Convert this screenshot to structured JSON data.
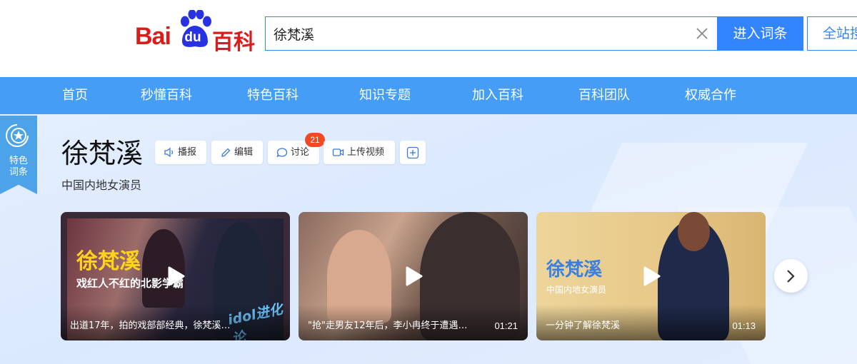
{
  "logo": {
    "part1": "Bai",
    "part2": "du",
    "part3": "百科"
  },
  "search": {
    "value": "徐梵溪",
    "placeholder": ""
  },
  "buttons": {
    "enter": "进入词条",
    "site_search": "全站搜索"
  },
  "nav": {
    "items": [
      "首页",
      "秒懂百科",
      "特色百科",
      "知识专题",
      "加入百科",
      "百科团队",
      "权威合作"
    ]
  },
  "badge": {
    "line1": "特色",
    "line2": "词条"
  },
  "entry": {
    "title": "徐梵溪",
    "subtitle": "中国内地女演员"
  },
  "actions": {
    "broadcast": "播报",
    "edit": "编辑",
    "discuss": "讨论",
    "discuss_count": "21",
    "upload_video": "上传视频"
  },
  "videos": [
    {
      "overlay_title": "徐梵溪",
      "overlay_sub": "戏红人不红的北影学霸",
      "overlay_logo": "idol进化论",
      "caption": "出道17年，拍的戏部部经典，徐梵溪…",
      "duration": ""
    },
    {
      "overlay_title": "",
      "overlay_sub": "",
      "overlay_logo": "",
      "caption": "\"抢\"走男友12年后，李小冉终于遭遇…",
      "duration": "01:21"
    },
    {
      "overlay_title": "徐梵溪",
      "overlay_sub": "中国内地女演员",
      "overlay_logo": "",
      "caption": "一分钟了解徐梵溪",
      "duration": "01:13"
    }
  ],
  "colors": {
    "brand_red": "#de1b1b",
    "accent_blue": "#3385ff",
    "nav_blue": "#459df5",
    "count_red": "#ef4a24"
  }
}
